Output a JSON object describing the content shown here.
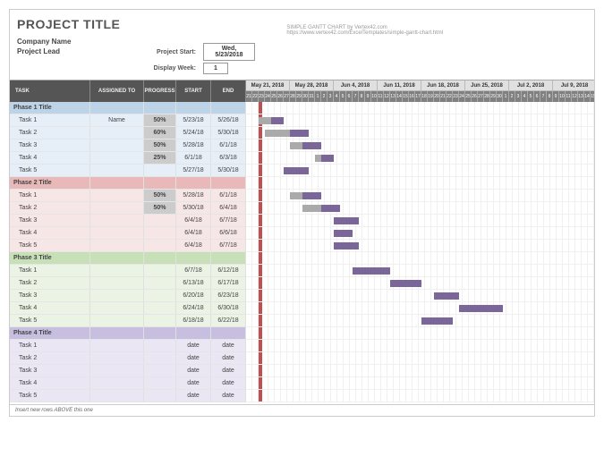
{
  "header": {
    "projectTitle": "PROJECT TITLE",
    "company": "Company Name",
    "lead": "Project Lead",
    "topRight1": "SIMPLE GANTT CHART by Vertex42.com",
    "topRight2": "https://www.vertex42.com/ExcelTemplates/simple-gantt-chart.html",
    "startLabel": "Project Start:",
    "startValue": "Wed, 5/23/2018",
    "weekLabel": "Display Week:",
    "weekValue": "1"
  },
  "columns": {
    "task": "TASK",
    "assigned": "ASSIGNED\nTO",
    "progress": "PROGRESS",
    "start": "START",
    "end": "END"
  },
  "weeks": [
    "May 21, 2018",
    "May 28, 2018",
    "Jun 4, 2018",
    "Jun 11, 2018",
    "Jun 18, 2018",
    "Jun 25, 2018",
    "Jul 2, 2018",
    "Jul 9, 2018"
  ],
  "days": [
    "21",
    "22",
    "23",
    "24",
    "25",
    "26",
    "27",
    "28",
    "29",
    "30",
    "31",
    "1",
    "2",
    "3",
    "4",
    "5",
    "6",
    "7",
    "8",
    "9",
    "10",
    "11",
    "12",
    "13",
    "14",
    "15",
    "16",
    "17",
    "18",
    "19",
    "20",
    "21",
    "22",
    "23",
    "24",
    "25",
    "26",
    "27",
    "28",
    "29",
    "30",
    "1",
    "2",
    "3",
    "4",
    "5",
    "6",
    "7",
    "8",
    "9",
    "10",
    "11",
    "12",
    "13",
    "14",
    "15"
  ],
  "phases": [
    {
      "id": "phase1",
      "cls": "p1",
      "title": "Phase 1 Title",
      "tasks": [
        {
          "name": "Task 1",
          "assigned": "Name",
          "progress": "50%",
          "start": "5/23/18",
          "end": "5/26/18",
          "barStart": 2,
          "barLen": 4,
          "progLen": 2
        },
        {
          "name": "Task 2",
          "assigned": "",
          "progress": "60%",
          "start": "5/24/18",
          "end": "5/30/18",
          "barStart": 3,
          "barLen": 7,
          "progLen": 4
        },
        {
          "name": "Task 3",
          "assigned": "",
          "progress": "50%",
          "start": "5/28/18",
          "end": "6/1/18",
          "barStart": 7,
          "barLen": 5,
          "progLen": 2
        },
        {
          "name": "Task 4",
          "assigned": "",
          "progress": "25%",
          "start": "6/1/18",
          "end": "6/3/18",
          "barStart": 11,
          "barLen": 3,
          "progLen": 1
        },
        {
          "name": "Task 5",
          "assigned": "",
          "progress": "",
          "start": "5/27/18",
          "end": "5/30/18",
          "barStart": 6,
          "barLen": 4,
          "progLen": 0
        }
      ]
    },
    {
      "id": "phase2",
      "cls": "p2",
      "title": "Phase 2 Title",
      "tasks": [
        {
          "name": "Task 1",
          "assigned": "",
          "progress": "50%",
          "start": "5/28/18",
          "end": "6/1/18",
          "barStart": 7,
          "barLen": 5,
          "progLen": 2
        },
        {
          "name": "Task 2",
          "assigned": "",
          "progress": "50%",
          "start": "5/30/18",
          "end": "6/4/18",
          "barStart": 9,
          "barLen": 6,
          "progLen": 3
        },
        {
          "name": "Task 3",
          "assigned": "",
          "progress": "",
          "start": "6/4/18",
          "end": "6/7/18",
          "barStart": 14,
          "barLen": 4,
          "progLen": 0
        },
        {
          "name": "Task 4",
          "assigned": "",
          "progress": "",
          "start": "6/4/18",
          "end": "6/6/18",
          "barStart": 14,
          "barLen": 3,
          "progLen": 0
        },
        {
          "name": "Task 5",
          "assigned": "",
          "progress": "",
          "start": "6/4/18",
          "end": "6/7/18",
          "barStart": 14,
          "barLen": 4,
          "progLen": 0
        }
      ]
    },
    {
      "id": "phase3",
      "cls": "p3",
      "title": "Phase 3 Title",
      "tasks": [
        {
          "name": "Task 1",
          "assigned": "",
          "progress": "",
          "start": "6/7/18",
          "end": "6/12/18",
          "barStart": 17,
          "barLen": 6,
          "progLen": 0
        },
        {
          "name": "Task 2",
          "assigned": "",
          "progress": "",
          "start": "6/13/18",
          "end": "6/17/18",
          "barStart": 23,
          "barLen": 5,
          "progLen": 0
        },
        {
          "name": "Task 3",
          "assigned": "",
          "progress": "",
          "start": "6/20/18",
          "end": "6/23/18",
          "barStart": 30,
          "barLen": 4,
          "progLen": 0
        },
        {
          "name": "Task 4",
          "assigned": "",
          "progress": "",
          "start": "6/24/18",
          "end": "6/30/18",
          "barStart": 34,
          "barLen": 7,
          "progLen": 0
        },
        {
          "name": "Task 5",
          "assigned": "",
          "progress": "",
          "start": "6/18/18",
          "end": "6/22/18",
          "barStart": 28,
          "barLen": 5,
          "progLen": 0
        }
      ]
    },
    {
      "id": "phase4",
      "cls": "p4",
      "title": "Phase 4 Title",
      "tasks": [
        {
          "name": "Task 1",
          "assigned": "",
          "progress": "",
          "start": "date",
          "end": "date",
          "barStart": 0,
          "barLen": 0,
          "progLen": 0
        },
        {
          "name": "Task 2",
          "assigned": "",
          "progress": "",
          "start": "date",
          "end": "date",
          "barStart": 0,
          "barLen": 0,
          "progLen": 0
        },
        {
          "name": "Task 3",
          "assigned": "",
          "progress": "",
          "start": "date",
          "end": "date",
          "barStart": 0,
          "barLen": 0,
          "progLen": 0
        },
        {
          "name": "Task 4",
          "assigned": "",
          "progress": "",
          "start": "date",
          "end": "date",
          "barStart": 0,
          "barLen": 0,
          "progLen": 0
        },
        {
          "name": "Task 5",
          "assigned": "",
          "progress": "",
          "start": "date",
          "end": "date",
          "barStart": 0,
          "barLen": 0,
          "progLen": 0
        }
      ]
    }
  ],
  "footerNote": "Insert new rows ABOVE this one",
  "chart_data": {
    "type": "gantt",
    "title": "Project Title — Simple Gantt Chart",
    "project_start": "2018-05-23",
    "display_week": 1,
    "x_range": [
      "2018-05-21",
      "2018-07-15"
    ],
    "today_marker": "2018-05-23",
    "weeks": [
      "2018-05-21",
      "2018-05-28",
      "2018-06-04",
      "2018-06-11",
      "2018-06-18",
      "2018-06-25",
      "2018-07-02",
      "2018-07-09"
    ],
    "series": [
      {
        "phase": "Phase 1",
        "task": "Task 1",
        "assigned": "Name",
        "progress": 0.5,
        "start": "2018-05-23",
        "end": "2018-05-26"
      },
      {
        "phase": "Phase 1",
        "task": "Task 2",
        "assigned": "",
        "progress": 0.6,
        "start": "2018-05-24",
        "end": "2018-05-30"
      },
      {
        "phase": "Phase 1",
        "task": "Task 3",
        "assigned": "",
        "progress": 0.5,
        "start": "2018-05-28",
        "end": "2018-06-01"
      },
      {
        "phase": "Phase 1",
        "task": "Task 4",
        "assigned": "",
        "progress": 0.25,
        "start": "2018-06-01",
        "end": "2018-06-03"
      },
      {
        "phase": "Phase 1",
        "task": "Task 5",
        "assigned": "",
        "progress": null,
        "start": "2018-05-27",
        "end": "2018-05-30"
      },
      {
        "phase": "Phase 2",
        "task": "Task 1",
        "assigned": "",
        "progress": 0.5,
        "start": "2018-05-28",
        "end": "2018-06-01"
      },
      {
        "phase": "Phase 2",
        "task": "Task 2",
        "assigned": "",
        "progress": 0.5,
        "start": "2018-05-30",
        "end": "2018-06-04"
      },
      {
        "phase": "Phase 2",
        "task": "Task 3",
        "assigned": "",
        "progress": null,
        "start": "2018-06-04",
        "end": "2018-06-07"
      },
      {
        "phase": "Phase 2",
        "task": "Task 4",
        "assigned": "",
        "progress": null,
        "start": "2018-06-04",
        "end": "2018-06-06"
      },
      {
        "phase": "Phase 2",
        "task": "Task 5",
        "assigned": "",
        "progress": null,
        "start": "2018-06-04",
        "end": "2018-06-07"
      },
      {
        "phase": "Phase 3",
        "task": "Task 1",
        "assigned": "",
        "progress": null,
        "start": "2018-06-07",
        "end": "2018-06-12"
      },
      {
        "phase": "Phase 3",
        "task": "Task 2",
        "assigned": "",
        "progress": null,
        "start": "2018-06-13",
        "end": "2018-06-17"
      },
      {
        "phase": "Phase 3",
        "task": "Task 3",
        "assigned": "",
        "progress": null,
        "start": "2018-06-20",
        "end": "2018-06-23"
      },
      {
        "phase": "Phase 3",
        "task": "Task 4",
        "assigned": "",
        "progress": null,
        "start": "2018-06-24",
        "end": "2018-06-30"
      },
      {
        "phase": "Phase 3",
        "task": "Task 5",
        "assigned": "",
        "progress": null,
        "start": "2018-06-18",
        "end": "2018-06-22"
      },
      {
        "phase": "Phase 4",
        "task": "Task 1",
        "assigned": "",
        "progress": null,
        "start": null,
        "end": null
      },
      {
        "phase": "Phase 4",
        "task": "Task 2",
        "assigned": "",
        "progress": null,
        "start": null,
        "end": null
      },
      {
        "phase": "Phase 4",
        "task": "Task 3",
        "assigned": "",
        "progress": null,
        "start": null,
        "end": null
      },
      {
        "phase": "Phase 4",
        "task": "Task 4",
        "assigned": "",
        "progress": null,
        "start": null,
        "end": null
      },
      {
        "phase": "Phase 4",
        "task": "Task 5",
        "assigned": "",
        "progress": null,
        "start": null,
        "end": null
      }
    ],
    "phase_colors": {
      "Phase 1": "#bcd3e8",
      "Phase 2": "#e9b8b8",
      "Phase 3": "#c8e0b8",
      "Phase 4": "#c8bfe0"
    },
    "bar_color": "#7a6699",
    "progress_bar_color": "#aaaaaa"
  }
}
